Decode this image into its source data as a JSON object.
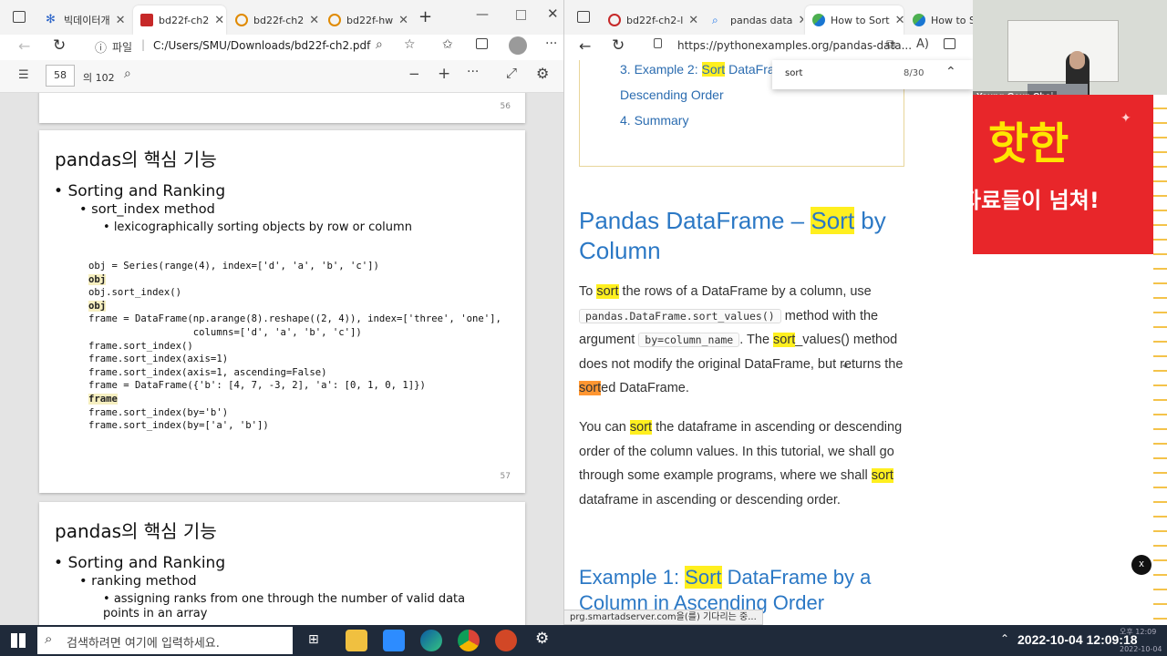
{
  "left_browser": {
    "tabs": [
      {
        "label": "빅데이터개"
      },
      {
        "label": "bd22f-ch2"
      },
      {
        "label": "bd22f-ch2"
      },
      {
        "label": "bd22f-hw"
      }
    ],
    "address": {
      "security_label": "파일",
      "url": "C:/Users/SMU/Downloads/bd22f-ch2.pdf"
    },
    "pdf_toolbar": {
      "page_number": "58",
      "page_total": "의 102"
    },
    "pages": [
      {
        "page_no": "56"
      },
      {
        "title": "pandas의 핵심 기능",
        "bullet1": "Sorting and Ranking",
        "bullet2": "sort_index method",
        "bullet3": "lexicographically sorting objects by row or column",
        "code_lines": [
          "obj = Series(range(4), index=['d', 'a', 'b', 'c'])",
          "obj",
          "obj.sort_index()",
          "obj",
          "frame = DataFrame(np.arange(8).reshape((2, 4)), index=['three', 'one'],",
          "                  columns=['d', 'a', 'b', 'c'])",
          "frame.sort_index()",
          "frame.sort_index(axis=1)",
          "frame.sort_index(axis=1, ascending=False)",
          "frame = DataFrame({'b': [4, 7, -3, 2], 'a': [0, 1, 0, 1]})",
          "frame",
          "frame.sort_index(by='b')",
          "frame.sort_index(by=['a', 'b'])"
        ],
        "page_no": "57"
      },
      {
        "title": "pandas의 핵심 기능",
        "bullet1": "Sorting and Ranking",
        "bullet2": "ranking method",
        "bullet3": "assigning ranks from one through the number of valid data points in an array"
      }
    ]
  },
  "right_browser": {
    "tabs": [
      {
        "label": "bd22f-ch2-l"
      },
      {
        "label": "pandas data"
      },
      {
        "label": "How to Sort"
      },
      {
        "label": "How to So"
      }
    ],
    "address": {
      "url": "https://pythonexamples.org/pandas-data..."
    },
    "find": {
      "query": "sort",
      "count": "8/30"
    },
    "toc": [
      {
        "pre": "3. Example 2: ",
        "hl": "Sort",
        "post": " DataFrame",
        "cont": "Descending Order"
      },
      {
        "text": "4. Summary"
      }
    ],
    "heading": {
      "pre": "Pandas DataFrame – ",
      "hl": "Sort",
      "post": " by",
      "line2": "Column"
    },
    "para1": {
      "t1": "To ",
      "hl1": "sort",
      "t2": " the rows of a DataFrame by a column, use ",
      "code1": "pandas.DataFrame.sort_values()",
      "t3": " method with the argument ",
      "code2": "by=column_name",
      "t4": ". The ",
      "hl2": "sort",
      "t5": "_values() method does not modify the original DataFrame, but returns the ",
      "hl3": "sort",
      "t6": "ed DataFrame."
    },
    "para2": {
      "t1": "You can ",
      "hl1": "sort",
      "t2": " the dataframe in ascending or descending order of the column values. In this tutorial, we shall go through some example programs, where we shall ",
      "hl2": "sort",
      "t3": " dataframe in ascending or descending order."
    },
    "heading2": {
      "pre": "Example 1: ",
      "hl": "Sort",
      "post": " DataFrame by a",
      "line2": "Column in Ascending Order"
    },
    "status": "prg.smartadserver.com을(를) 기다리는 중..."
  },
  "webcam": {
    "name": "Young-Geun Choi"
  },
  "ad": {
    "line1": "핫한",
    "line2": "자료들이 넘쳐!"
  },
  "close_badge": "x",
  "taskbar": {
    "search_placeholder": "검색하려면 여기에 입력하세요.",
    "datetime": "2022-10-04 12:09:18",
    "clock_small_top": "오후 12:09",
    "clock_small_bottom": "2022-10-04"
  },
  "colors": {
    "link": "#2b6cb0",
    "heading": "#2b78c5",
    "highlight": "#ffef1f",
    "highlight_active": "#ff9632",
    "ad_red": "#e8262a",
    "ad_yellow": "#ffe600"
  }
}
